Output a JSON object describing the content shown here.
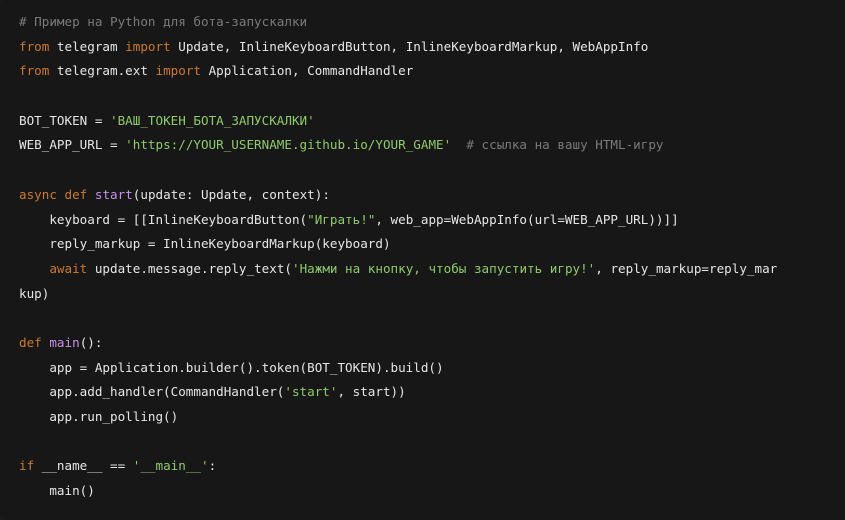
{
  "code": {
    "language": "python",
    "lines": [
      [
        {
          "t": "comment",
          "v": "# Пример на Python для бота-запускалки"
        }
      ],
      [
        {
          "t": "keyword",
          "v": "from"
        },
        {
          "t": "plain",
          "v": " telegram "
        },
        {
          "t": "keyword",
          "v": "import"
        },
        {
          "t": "plain",
          "v": " Update, InlineKeyboardButton, InlineKeyboardMarkup, WebAppInfo"
        }
      ],
      [
        {
          "t": "keyword",
          "v": "from"
        },
        {
          "t": "plain",
          "v": " telegram.ext "
        },
        {
          "t": "keyword",
          "v": "import"
        },
        {
          "t": "plain",
          "v": " Application, CommandHandler"
        }
      ],
      [],
      [
        {
          "t": "plain",
          "v": "BOT_TOKEN = "
        },
        {
          "t": "string",
          "v": "'ВАШ_ТОКЕН_БОТА_ЗАПУСКАЛКИ'"
        }
      ],
      [
        {
          "t": "plain",
          "v": "WEB_APP_URL = "
        },
        {
          "t": "string",
          "v": "'https://YOUR_USERNAME.github.io/YOUR_GAME'"
        },
        {
          "t": "plain",
          "v": "  "
        },
        {
          "t": "comment",
          "v": "# ссылка на вашу HTML-игру"
        }
      ],
      [],
      [
        {
          "t": "keyword",
          "v": "async"
        },
        {
          "t": "plain",
          "v": " "
        },
        {
          "t": "keyword",
          "v": "def"
        },
        {
          "t": "plain",
          "v": " "
        },
        {
          "t": "func",
          "v": "start"
        },
        {
          "t": "plain",
          "v": "(update: Update, context):"
        }
      ],
      [
        {
          "t": "plain",
          "v": "    keyboard = [[InlineKeyboardButton("
        },
        {
          "t": "string",
          "v": "\"Играть!\""
        },
        {
          "t": "plain",
          "v": ", web_app=WebAppInfo(url=WEB_APP_URL))]]"
        }
      ],
      [
        {
          "t": "plain",
          "v": "    reply_markup = InlineKeyboardMarkup(keyboard)"
        }
      ],
      [
        {
          "t": "plain",
          "v": "    "
        },
        {
          "t": "keyword",
          "v": "await"
        },
        {
          "t": "plain",
          "v": " update.message.reply_text("
        },
        {
          "t": "string",
          "v": "'Нажми на кнопку, чтобы запустить игру!'"
        },
        {
          "t": "plain",
          "v": ", reply_markup=reply_mar"
        }
      ],
      [
        {
          "t": "plain",
          "v": "kup)"
        }
      ],
      [],
      [
        {
          "t": "keyword",
          "v": "def"
        },
        {
          "t": "plain",
          "v": " "
        },
        {
          "t": "func",
          "v": "main"
        },
        {
          "t": "plain",
          "v": "():"
        }
      ],
      [
        {
          "t": "plain",
          "v": "    app = Application.builder().token(BOT_TOKEN).build()"
        }
      ],
      [
        {
          "t": "plain",
          "v": "    app.add_handler(CommandHandler("
        },
        {
          "t": "string",
          "v": "'start'"
        },
        {
          "t": "plain",
          "v": ", start))"
        }
      ],
      [
        {
          "t": "plain",
          "v": "    app.run_polling()"
        }
      ],
      [],
      [
        {
          "t": "keyword",
          "v": "if"
        },
        {
          "t": "plain",
          "v": " __name__ == "
        },
        {
          "t": "string",
          "v": "'__main__'"
        },
        {
          "t": "plain",
          "v": ":"
        }
      ],
      [
        {
          "t": "plain",
          "v": "    main()"
        }
      ]
    ]
  },
  "colors": {
    "background": "#171717",
    "comment": "#7a7a7a",
    "keyword": "#cc7832",
    "function": "#c792ea",
    "string": "#8ecb6a",
    "plain": "#e6e6e6"
  }
}
